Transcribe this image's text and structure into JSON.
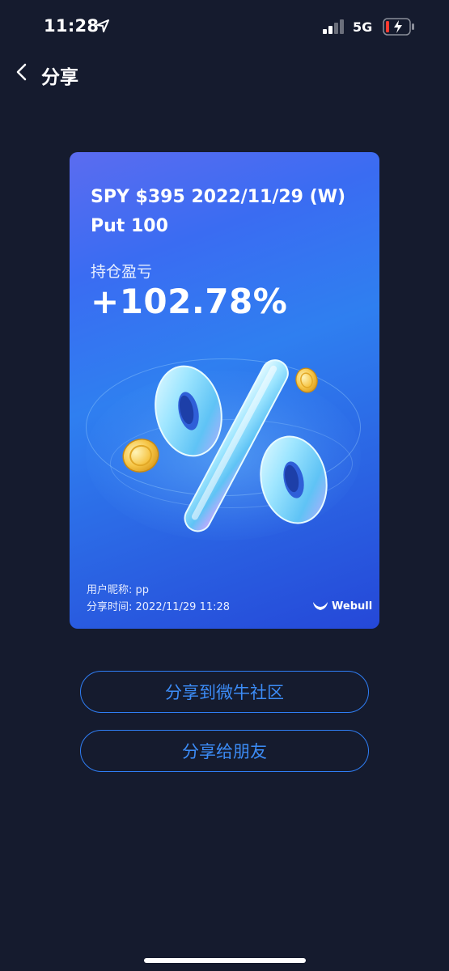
{
  "status_bar": {
    "time": "11:28",
    "network": "5G",
    "icons": [
      "location-arrow-icon",
      "signal-bars-icon",
      "battery-charging-icon"
    ]
  },
  "nav": {
    "back_icon": "chevron-left-icon",
    "title": "分享"
  },
  "card": {
    "ticker_line1": "SPY $395 2022/11/29 (W)",
    "ticker_line2": "Put 100",
    "pnl_label": "持仓盈亏",
    "pnl_value": "+102.78%",
    "nickname": "用户昵称: pp",
    "share_time": "分享时间: 2022/11/29 11:28",
    "brand": "Webull",
    "art_icon": "percent-icon",
    "colors": {
      "gradient_top": "#5b6cf0",
      "gradient_bottom": "#2548d8"
    }
  },
  "actions": {
    "share_community": "分享到微牛社区",
    "share_friends": "分享给朋友",
    "accent": "#2f7ef5"
  }
}
